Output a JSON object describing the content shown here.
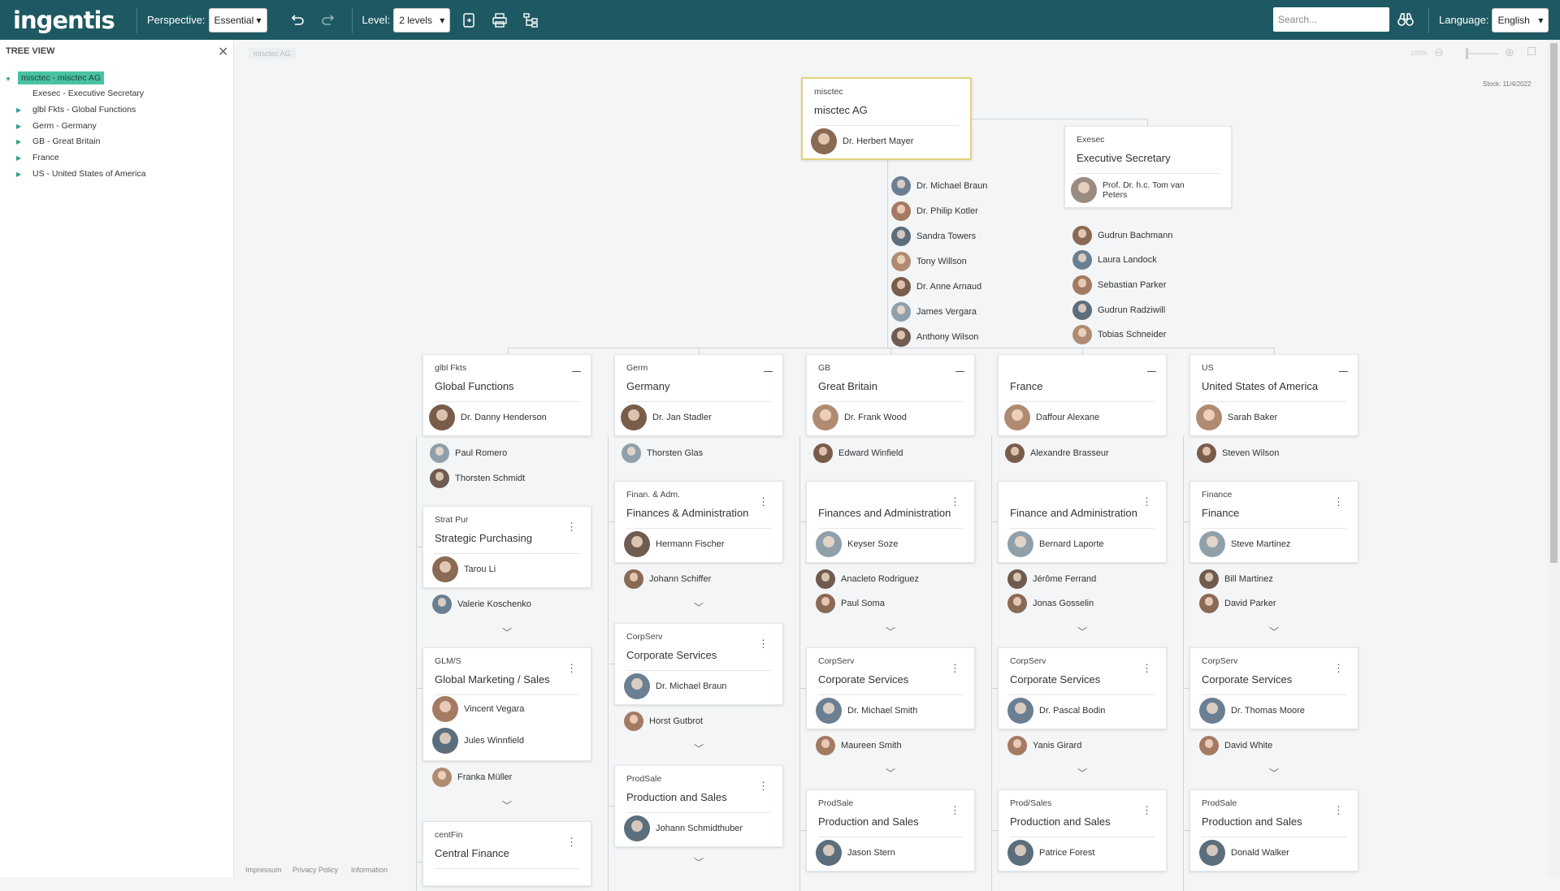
{
  "app": {
    "logo": "ingentis",
    "perspective_label": "Perspective:",
    "perspective_value": "Essential",
    "level_label": "Level:",
    "level_value": "2 levels",
    "search_placeholder": "Search...",
    "language_label": "Language:",
    "language_value": "English"
  },
  "sidebar": {
    "title": "TREE VIEW",
    "items": [
      {
        "label": "misctec - misctec AG",
        "selected": true
      },
      {
        "label": "Exesec - Executive Secretary"
      },
      {
        "label": "glbl Fkts - Global Functions"
      },
      {
        "label": "Germ - Germany"
      },
      {
        "label": "GB - Great Britain"
      },
      {
        "label": "France"
      },
      {
        "label": "US - United States of America"
      }
    ]
  },
  "canvas": {
    "breadcrumb": "misctec AG",
    "stock": "Stock: 11/4/2022",
    "zoom": "100%"
  },
  "root": {
    "abbr": "misctec",
    "name": "misctec AG",
    "head": "Dr. Herbert Mayer",
    "staff": [
      "Dr. Michael Braun",
      "Dr. Philip Kotler",
      "Sandra Towers",
      "Tony Willson",
      "Dr. Anne Arnaud",
      "James Vergara",
      "Anthony Wilson"
    ]
  },
  "exec": {
    "abbr": "Exesec",
    "name": "Executive Secretary",
    "head": "Prof. Dr. h.c. Tom van Peters",
    "staff": [
      "Gudrun Bachmann",
      "Laura Landock",
      "Sebastian Parker",
      "Gudrun Radziwill",
      "Tobias Schneider"
    ]
  },
  "columns": [
    {
      "abbr": "glbl Fkts",
      "name": "Global Functions",
      "head": "Dr. Danny Henderson",
      "staff": [
        "Paul Romero",
        "Thorsten Schmidt"
      ],
      "units": [
        {
          "abbr": "Strat Pur",
          "name": "Strategic Purchasing",
          "heads": [
            "Tarou Li"
          ],
          "staff": [
            "Valerie Koschenko"
          ]
        },
        {
          "abbr": "GLM/S",
          "name": "Global Marketing / Sales",
          "heads": [
            "Vincent Vegara",
            "Jules Winnfield"
          ],
          "staff": [
            "Franka Müller"
          ]
        },
        {
          "abbr": "centFin",
          "name": "Central Finance",
          "heads": [],
          "staff": []
        }
      ]
    },
    {
      "abbr": "Germ",
      "name": "Germany",
      "head": "Dr. Jan Stadler",
      "staff": [
        "Thorsten Glas"
      ],
      "units": [
        {
          "abbr": "Finan. & Adm.",
          "name": "Finances & Administration",
          "heads": [
            "Hermann Fischer"
          ],
          "staff": [
            "Johann Schiffer"
          ]
        },
        {
          "abbr": "CorpServ",
          "name": "Corporate Services",
          "heads": [
            "Dr. Michael Braun"
          ],
          "staff": [
            "Horst Gutbrot"
          ]
        },
        {
          "abbr": "ProdSale",
          "name": "Production and Sales",
          "heads": [
            "Johann Schmidthuber"
          ],
          "staff": []
        }
      ]
    },
    {
      "abbr": "GB",
      "name": "Great Britain",
      "head": "Dr. Frank Wood",
      "staff": [
        "Edward Winfield"
      ],
      "units": [
        {
          "abbr": "",
          "name": "Finances and Administration",
          "heads": [
            "Keyser Soze"
          ],
          "staff": [
            "Anacleto Rodriguez",
            "Paul Soma"
          ]
        },
        {
          "abbr": "CorpServ",
          "name": "Corporate Services",
          "heads": [
            "Dr. Michael Smith"
          ],
          "staff": [
            "Maureen Smith"
          ]
        },
        {
          "abbr": "ProdSale",
          "name": "Production and Sales",
          "heads": [
            "Jason Stern"
          ],
          "staff": []
        }
      ]
    },
    {
      "abbr": "",
      "name": "France",
      "head": "Daffour Alexane",
      "staff": [
        "Alexandre Brasseur"
      ],
      "units": [
        {
          "abbr": "",
          "name": "Finance and Administration",
          "heads": [
            "Bernard Laporte"
          ],
          "staff": [
            "Jérôme Ferrand",
            "Jonas Gosselin"
          ]
        },
        {
          "abbr": "CorpServ",
          "name": "Corporate Services",
          "heads": [
            "Dr. Pascal Bodin"
          ],
          "staff": [
            "Yanis Girard"
          ]
        },
        {
          "abbr": "Prod/Sales",
          "name": "Production and Sales",
          "heads": [
            "Patrice Forest"
          ],
          "staff": []
        }
      ]
    },
    {
      "abbr": "US",
      "name": "United States of America",
      "head": "Sarah Baker",
      "staff": [
        "Steven Wilson"
      ],
      "units": [
        {
          "abbr": "Finance",
          "name": "Finance",
          "heads": [
            "Steve Martinez"
          ],
          "staff": [
            "Bill Martinez",
            "David Parker"
          ]
        },
        {
          "abbr": "CorpServ",
          "name": "Corporate Services",
          "heads": [
            "Dr. Thomas Moore"
          ],
          "staff": [
            "David White"
          ]
        },
        {
          "abbr": "ProdSale",
          "name": "Production and Sales",
          "heads": [
            "Donald Walker"
          ],
          "staff": []
        }
      ]
    }
  ],
  "footer": {
    "impressum": "Impressum",
    "privacy": "Privacy Policy",
    "information": "Information"
  },
  "colors": {
    "topbar": "#1e5963",
    "selected": "#48c2a2",
    "root_border": "#e3d27a"
  }
}
